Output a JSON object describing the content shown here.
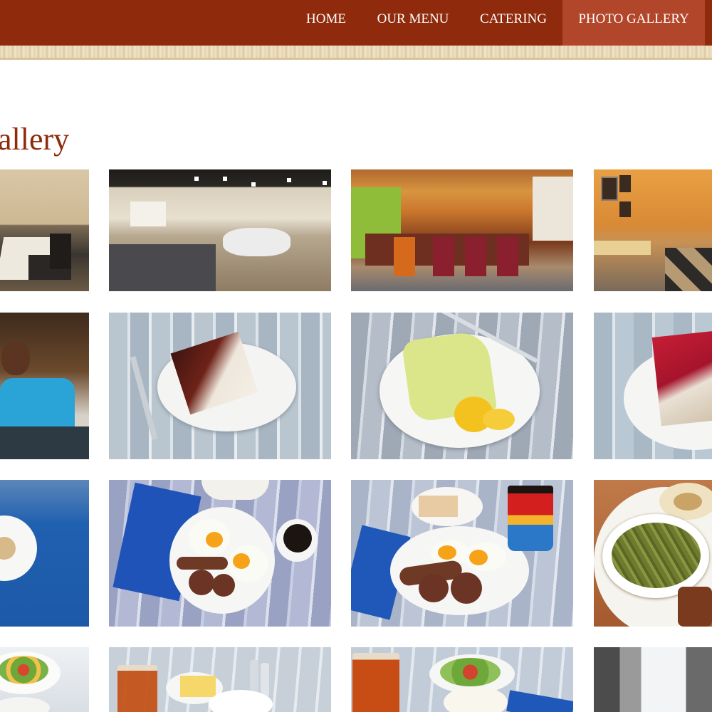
{
  "nav": {
    "items": [
      {
        "label": "HOME",
        "active": false
      },
      {
        "label": "OUR MENU",
        "active": false
      },
      {
        "label": "CATERING",
        "active": false
      },
      {
        "label": "PHOTO GALLERY",
        "active": true
      }
    ],
    "colors": {
      "background": "#8f2a0c",
      "active": "#b2462a",
      "text": "#ffffff"
    }
  },
  "page": {
    "title": "allery",
    "title_color": "#8f2a0c"
  },
  "gallery": {
    "photos": [
      "dining-room-tables-photo",
      "banquet-hall-photo",
      "bar-counter-stools-photo",
      "dining-room-framed-pictures-photo",
      "smiling-staff-member-photo",
      "chocolate-cake-slice-photo",
      "lemon-cake-slice-photo",
      "red-velvet-cake-slice-photo",
      "blue-napkin-side-dish-photo",
      "eggs-sausage-coffee-photo",
      "eggs-sausage-mug-photo",
      "green-beans-plate-photo",
      "salad-plate-photo",
      "iced-tea-bread-photo",
      "iced-tea-salad-photo",
      "window-photo"
    ]
  }
}
